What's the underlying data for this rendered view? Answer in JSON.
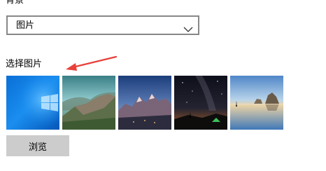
{
  "background": {
    "label": "背景",
    "dropdown_value": "图片",
    "dropdown_icon": "chevron-down-icon"
  },
  "choose_picture": {
    "label": "选择图片",
    "annotation_arrow_color": "#e8413b",
    "thumbnails": [
      {
        "name": "windows-blue-logo"
      },
      {
        "name": "mountain-ridge-lake"
      },
      {
        "name": "alpine-peaks-sunset"
      },
      {
        "name": "night-sky-milky-way-tent"
      },
      {
        "name": "beach-rocks-reflection"
      }
    ]
  },
  "browse_button": {
    "label": "浏览"
  },
  "colors": {
    "dropdown_border": "#888888",
    "button_bg": "#cccccc"
  }
}
